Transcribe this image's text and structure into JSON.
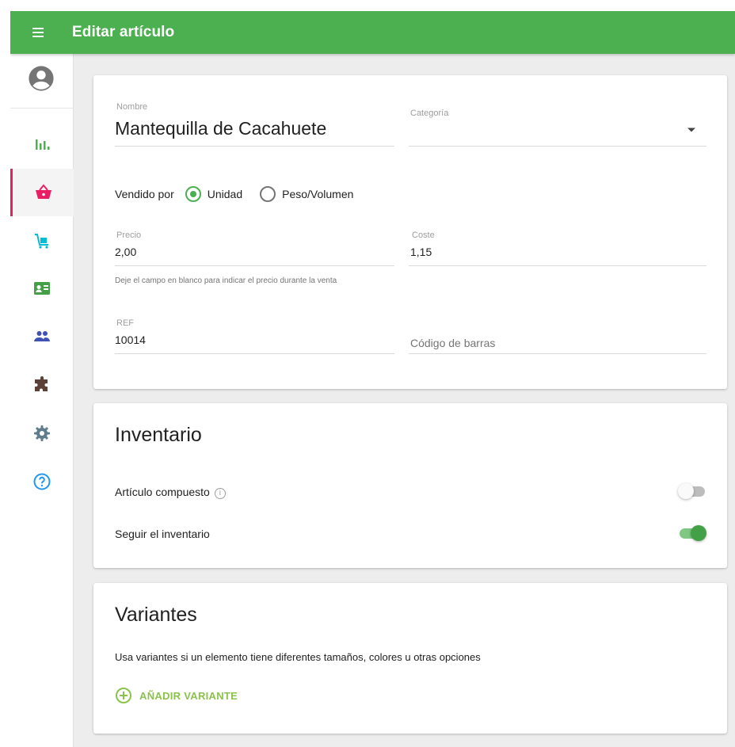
{
  "app": {
    "title": "Editar artículo"
  },
  "sidebar": {
    "items": [
      {
        "icon": "reports-icon",
        "color": "#4caf50"
      },
      {
        "icon": "basket-icon",
        "color": "#e91e63",
        "active": true
      },
      {
        "icon": "inventory-icon",
        "color": "#00bcd4"
      },
      {
        "icon": "employees-icon",
        "color": "#43a047"
      },
      {
        "icon": "customers-icon",
        "color": "#3f51b5"
      },
      {
        "icon": "integrations-icon",
        "color": "#5d4037"
      },
      {
        "icon": "settings-icon",
        "color": "#607d8b"
      },
      {
        "icon": "help-icon",
        "color": "#2196f3"
      }
    ]
  },
  "item_form": {
    "name_label": "Nombre",
    "name_value": "Mantequilla de Cacahuete",
    "category_label": "Categoría",
    "category_value": "",
    "sold_by_label": "Vendido por",
    "sold_by_options": [
      "Unidad",
      "Peso/Volumen"
    ],
    "sold_by_selected": "Unidad",
    "price_label": "Precio",
    "price_value": "2,00",
    "price_helper": "Deje el campo en blanco para indicar el precio durante la venta",
    "cost_label": "Coste",
    "cost_value": "1,15",
    "ref_label": "REF",
    "ref_value": "10014",
    "barcode_placeholder": "Código de barras"
  },
  "inventory": {
    "title": "Inventario",
    "composite_label": "Artículo compuesto",
    "composite_enabled": false,
    "track_label": "Seguir el inventario",
    "track_enabled": true
  },
  "variants": {
    "title": "Variantes",
    "description": "Usa variantes si un elemento tiene diferentes tamaños, colores u otras opciones",
    "add_label": "AÑADIR VARIANTE"
  },
  "colors": {
    "appbar": "#4caf50",
    "accent": "#8bc34a",
    "active_nav": "#e91e63"
  }
}
